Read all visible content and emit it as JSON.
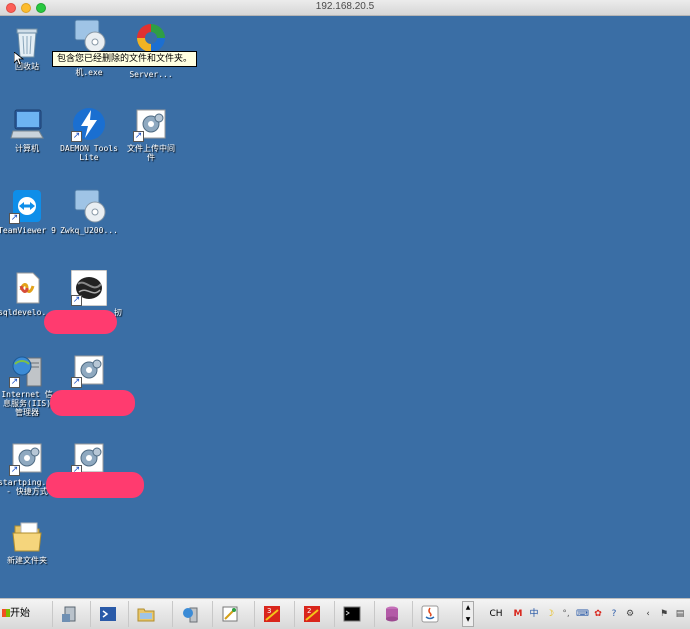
{
  "window": {
    "title": "192.168.20.5"
  },
  "tooltip": {
    "text": "包含您已经删除的文件和文件夹。"
  },
  "desktop": {
    "icons": [
      {
        "id": "recycle",
        "label": "回收站"
      },
      {
        "id": "vm",
        "label": "机.exe"
      },
      {
        "id": "server",
        "label": "Server..."
      },
      {
        "id": "computer",
        "label": "计算机"
      },
      {
        "id": "daemon",
        "label": "DAEMON Tools\nLite"
      },
      {
        "id": "upload",
        "label": "文件上传中间\n件"
      },
      {
        "id": "teamviewer",
        "label": "TeamViewer 9"
      },
      {
        "id": "zwkq",
        "label": "Zwkq_U200..."
      },
      {
        "id": "sqldev",
        "label": "sqldevelo..."
      },
      {
        "id": "redacted1",
        "label": "扨"
      },
      {
        "id": "iis",
        "label": "Internet 信\n息服务(IIS)\n管理器"
      },
      {
        "id": "startping",
        "label": "startping...\n- 快捷方式"
      },
      {
        "id": "newfolder",
        "label": "新建文件夹"
      }
    ]
  },
  "taskbar": {
    "start_label": "开始",
    "tray_lang": "CH"
  },
  "colors": {
    "desktop": "#3a6ea5",
    "redaction": "#ff3b6f",
    "tooltip_bg": "#ffffe1"
  }
}
